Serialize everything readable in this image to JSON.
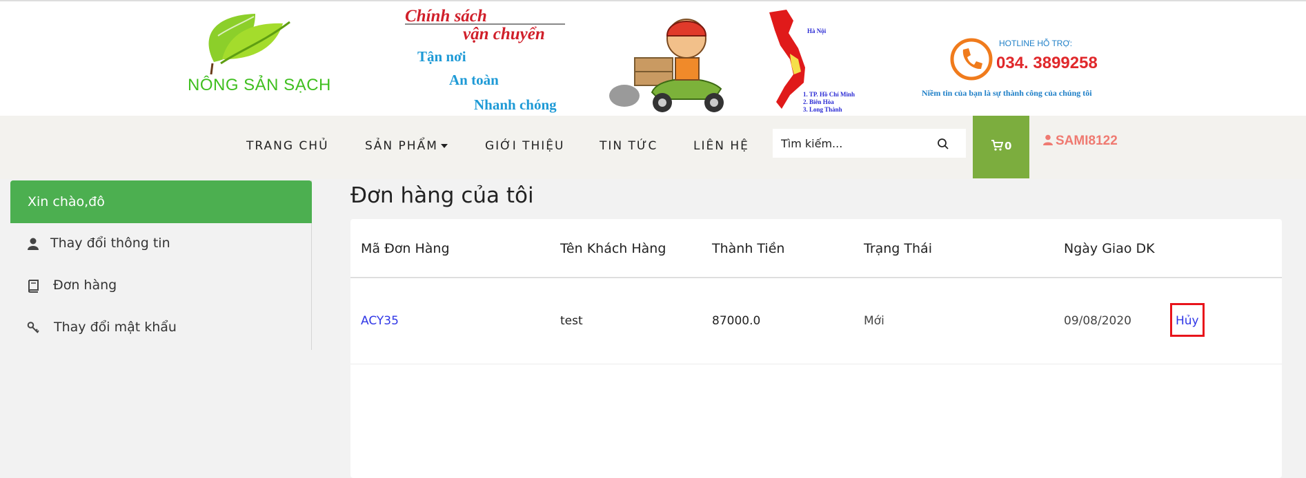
{
  "banner": {
    "logo_text": "NÔNG SẢN SẠCH",
    "policy_line1": "Chính sách",
    "policy_line2": "vận chuyển",
    "policy_tag1": "Tận nơi",
    "policy_tag2": "An toàn",
    "policy_tag3": "Nhanh chóng",
    "map_city": "Hà Nội",
    "map_list": [
      "1. TP. Hồ Chí Minh",
      "2. Biên Hòa",
      "3. Long Thành"
    ],
    "hotline_label": "HOTLINE HỖ TRỢ:",
    "hotline_number": "034. 3899258",
    "slogan": "Niềm tin của bạn là sự thành công của chúng tôi"
  },
  "nav": {
    "home": "TRANG CHỦ",
    "products": "SẢN PHẨM",
    "about": "GIỚI THIỆU",
    "news": "TIN TỨC",
    "contact": "LIÊN HỆ",
    "search_placeholder": "Tìm kiếm...",
    "cart_count": "0",
    "username": "SAMI8122"
  },
  "sidebar": {
    "greeting": "Xin chào,đô",
    "items": [
      {
        "label": "Thay đổi thông tin",
        "icon": "user-icon"
      },
      {
        "label": "Đơn hàng",
        "icon": "book-icon"
      },
      {
        "label": "Thay đổi mật khẩu",
        "icon": "key-icon"
      }
    ]
  },
  "main": {
    "title": "Đơn hàng của tôi",
    "columns": [
      "Mã Đơn Hàng",
      "Tên Khách Hàng",
      "Thành Tiền",
      "Trạng Thái",
      "Ngày Giao DK"
    ],
    "rows": [
      {
        "id": "ACY35",
        "customer": "test",
        "total": "87000.0",
        "status": "Mới",
        "date": "09/08/2020",
        "action": "Hủy"
      }
    ]
  },
  "colors": {
    "green": "#4caf50",
    "cart_green": "#7cad3e",
    "link_blue": "#2f36e6",
    "user_pink": "#ef7a71",
    "highlight_red": "#e8141b"
  }
}
